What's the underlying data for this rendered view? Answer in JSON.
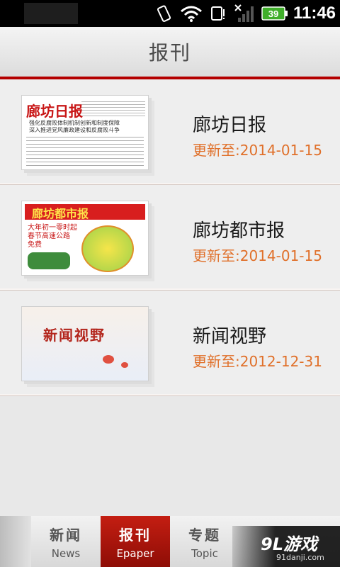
{
  "status_bar": {
    "battery": "39",
    "time": "11:46"
  },
  "header": {
    "title": "报刊"
  },
  "papers": [
    {
      "name": "廊坊日报",
      "updated": "更新至:2014-01-15",
      "thumb_masthead": "廊坊日报",
      "thumb_lines": [
        "强化反腐败体制机制创新和制度保障",
        "深入推进党风廉政建设和反腐败斗争"
      ]
    },
    {
      "name": "廊坊都市报",
      "updated": "更新至:2014-01-15",
      "thumb_masthead": "廊坊都市报",
      "thumb_lines": [
        "大年初一零时起",
        "春节高速公路",
        "免费"
      ]
    },
    {
      "name": "新闻视野",
      "updated": "更新至:2012-12-31",
      "thumb_masthead": "新闻视野"
    }
  ],
  "tabs": [
    {
      "zh": "新闻",
      "en": "News",
      "active": false
    },
    {
      "zh": "报刊",
      "en": "Epaper",
      "active": true
    },
    {
      "zh": "专题",
      "en": "Topic",
      "active": false
    }
  ],
  "watermark": {
    "logo": "9L游戏",
    "url": "91danji.com"
  },
  "colors": {
    "accent_red": "#b40000",
    "date_orange": "#e0702a"
  }
}
